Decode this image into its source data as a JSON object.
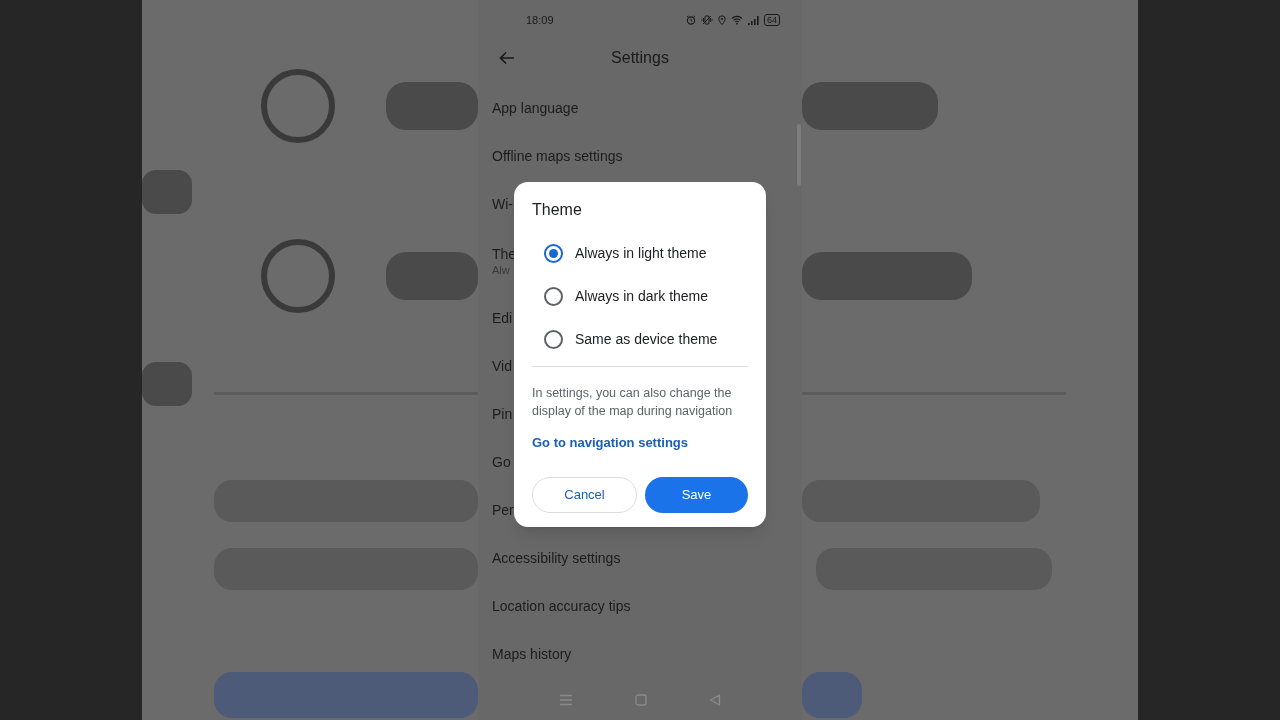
{
  "status_bar": {
    "time": "18:09",
    "battery": "64"
  },
  "header": {
    "title": "Settings"
  },
  "settings_items": [
    {
      "title": "App language"
    },
    {
      "title": "Offline maps settings"
    },
    {
      "title": "Wi-"
    },
    {
      "title": "The",
      "subtitle": "Alw"
    },
    {
      "title": "Edi"
    },
    {
      "title": "Vid"
    },
    {
      "title": "Pin"
    },
    {
      "title": "Go"
    },
    {
      "title": "Per"
    },
    {
      "title": "Accessibility settings"
    },
    {
      "title": "Location accuracy tips"
    },
    {
      "title": "Maps history"
    }
  ],
  "dialog": {
    "title": "Theme",
    "options": [
      {
        "label": "Always in light theme",
        "selected": true
      },
      {
        "label": "Always in dark theme",
        "selected": false
      },
      {
        "label": "Same as device theme",
        "selected": false
      }
    ],
    "note": "In settings, you can also change the display of the map during navigation",
    "link": "Go to navigation settings",
    "buttons": [
      {
        "label": "Cancel",
        "kind": "outlined"
      },
      {
        "label": "Save",
        "kind": "filled"
      }
    ]
  }
}
